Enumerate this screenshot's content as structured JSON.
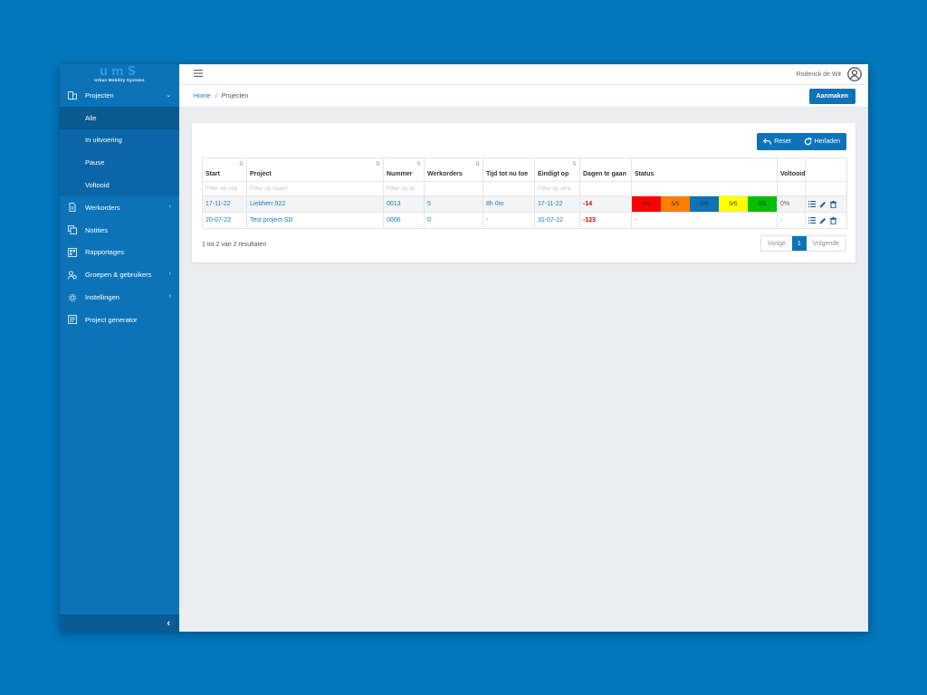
{
  "logo": {
    "mark": "umS",
    "sub": "Urban Mobility Systems"
  },
  "sidebar": {
    "items": [
      {
        "label": "Projecten",
        "icon": "building-icon",
        "chevron": "⌄"
      },
      {
        "label": "Werkorders",
        "icon": "document-icon",
        "chevron": "‹"
      },
      {
        "label": "Notities",
        "icon": "notes-icon",
        "chevron": ""
      },
      {
        "label": "Rapportages",
        "icon": "report-icon",
        "chevron": ""
      },
      {
        "label": "Groepen & gebruikers",
        "icon": "users-icon",
        "chevron": "‹"
      },
      {
        "label": "Instellingen",
        "icon": "gear-icon",
        "chevron": "‹"
      },
      {
        "label": "Project generator",
        "icon": "generator-icon",
        "chevron": ""
      }
    ],
    "subitems": [
      {
        "label": "Alle"
      },
      {
        "label": "In uitvoering"
      },
      {
        "label": "Pause"
      },
      {
        "label": "Voltooid"
      }
    ],
    "collapse": "‹"
  },
  "topbar": {
    "user": "Roderick de Wit"
  },
  "breadcrumb": {
    "home": "Home",
    "current": "Projecten"
  },
  "create_button": "Aanmaken",
  "tools": {
    "reset": "Reset",
    "reload": "Herladen"
  },
  "table": {
    "headers": [
      "Start",
      "Project",
      "Nummer",
      "Werkorders",
      "Tijd tot nu toe",
      "Eindigt op",
      "Dagen te gaan",
      "Status",
      "Voltooid",
      ""
    ],
    "filters": [
      "Filter op star",
      "Filter op naam",
      "Filter op pr",
      "",
      "",
      "Filter op einc",
      "",
      "",
      "",
      ""
    ],
    "rows": [
      {
        "start": "17-11-22",
        "project": "Liebherr 922",
        "nummer": "0013",
        "werkorders": "5",
        "tijd": "8h 0m",
        "eindigt": "17-11-22",
        "dagen": "-14",
        "status": [
          "0/5",
          "5/5",
          "0/5",
          "0/5",
          "0/5"
        ],
        "voltooid": "0%"
      },
      {
        "start": "20-07-22",
        "project": "Test project SD",
        "nummer": "0006",
        "werkorders": "0",
        "tijd": "-",
        "eindigt": "31-07-22",
        "dagen": "-123",
        "status_text": "-",
        "voltooid": "-"
      }
    ]
  },
  "status_colors": [
    "#ff0000",
    "#ff7f00",
    "#0d73b8",
    "#ffff00",
    "#00c000"
  ],
  "footer": {
    "results": "1 tot 2 van 2 resultaten"
  },
  "pager": {
    "prev": "Vorige",
    "current": "1",
    "next": "Volgende"
  }
}
